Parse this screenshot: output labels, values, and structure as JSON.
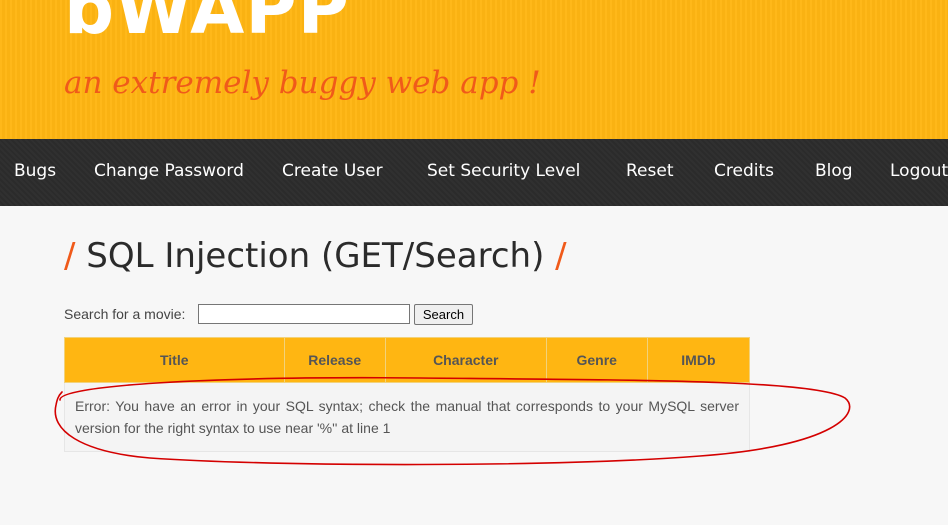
{
  "header": {
    "logo": "bWAPP",
    "tagline": "an extremely buggy web app !"
  },
  "nav": {
    "items": [
      "Bugs",
      "Change Password",
      "Create User",
      "Set Security Level",
      "Reset",
      "Credits",
      "Blog",
      "Logout"
    ]
  },
  "page": {
    "title": "SQL Injection (GET/Search)",
    "slash": "/"
  },
  "search": {
    "label": "Search for a movie:",
    "value": "",
    "button": "Search"
  },
  "table": {
    "headers": [
      "Title",
      "Release",
      "Character",
      "Genre",
      "IMDb"
    ],
    "error": "Error: You have an error in your SQL syntax; check the manual that corresponds to your MySQL server version for the right syntax to use near '%'' at line 1"
  },
  "colors": {
    "brand": "#ffb612",
    "accent": "#f05a1a",
    "nav_bg": "#2b2b2b",
    "annotation": "#d40000"
  }
}
